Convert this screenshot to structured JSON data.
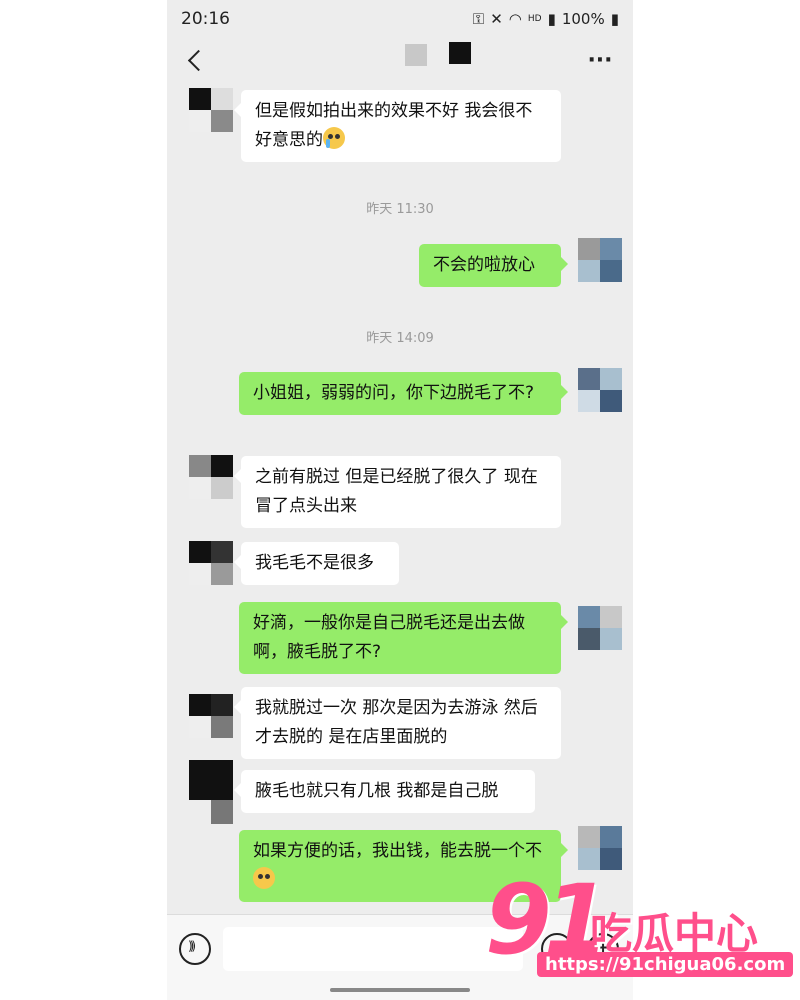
{
  "status_bar": {
    "time": "20:16",
    "battery": "100%",
    "network": "HD"
  },
  "nav": {
    "back_icon": "chevron-left-icon",
    "more_label": "···"
  },
  "messages": [
    {
      "side": "left",
      "text": "但是假如拍出来的效果不好 我会很不好意思的",
      "emoji": "crying-face"
    },
    {
      "timestamp": "昨天 11:30"
    },
    {
      "side": "right",
      "text": "不会的啦放心"
    },
    {
      "timestamp": "昨天 14:09"
    },
    {
      "side": "right",
      "text": "小姐姐，弱弱的问，你下边脱毛了不?"
    },
    {
      "side": "left",
      "text": "之前有脱过 但是已经脱了很久了 现在冒了点头出来"
    },
    {
      "side": "left",
      "text": "我毛毛不是很多"
    },
    {
      "side": "right",
      "text": "好滴，一般你是自己脱毛还是出去做啊，腋毛脱了不?"
    },
    {
      "side": "left",
      "text": "我就脱过一次 那次是因为去游泳 然后才去脱的 是在店里面脱的"
    },
    {
      "side": "left",
      "text": "腋毛也就只有几根 我都是自己脱"
    },
    {
      "side": "right",
      "text": "如果方便的话，我出钱，能去脱一个不",
      "emoji": "pleading-face"
    }
  ],
  "colors": {
    "chat_bg": "#ededed",
    "incoming_bubble": "#ffffff",
    "outgoing_bubble": "#95ec69",
    "watermark": "#ff4f8b"
  },
  "watermark": {
    "number": "91",
    "name": "吃瓜中心",
    "url": "https://91chigua06.com"
  }
}
